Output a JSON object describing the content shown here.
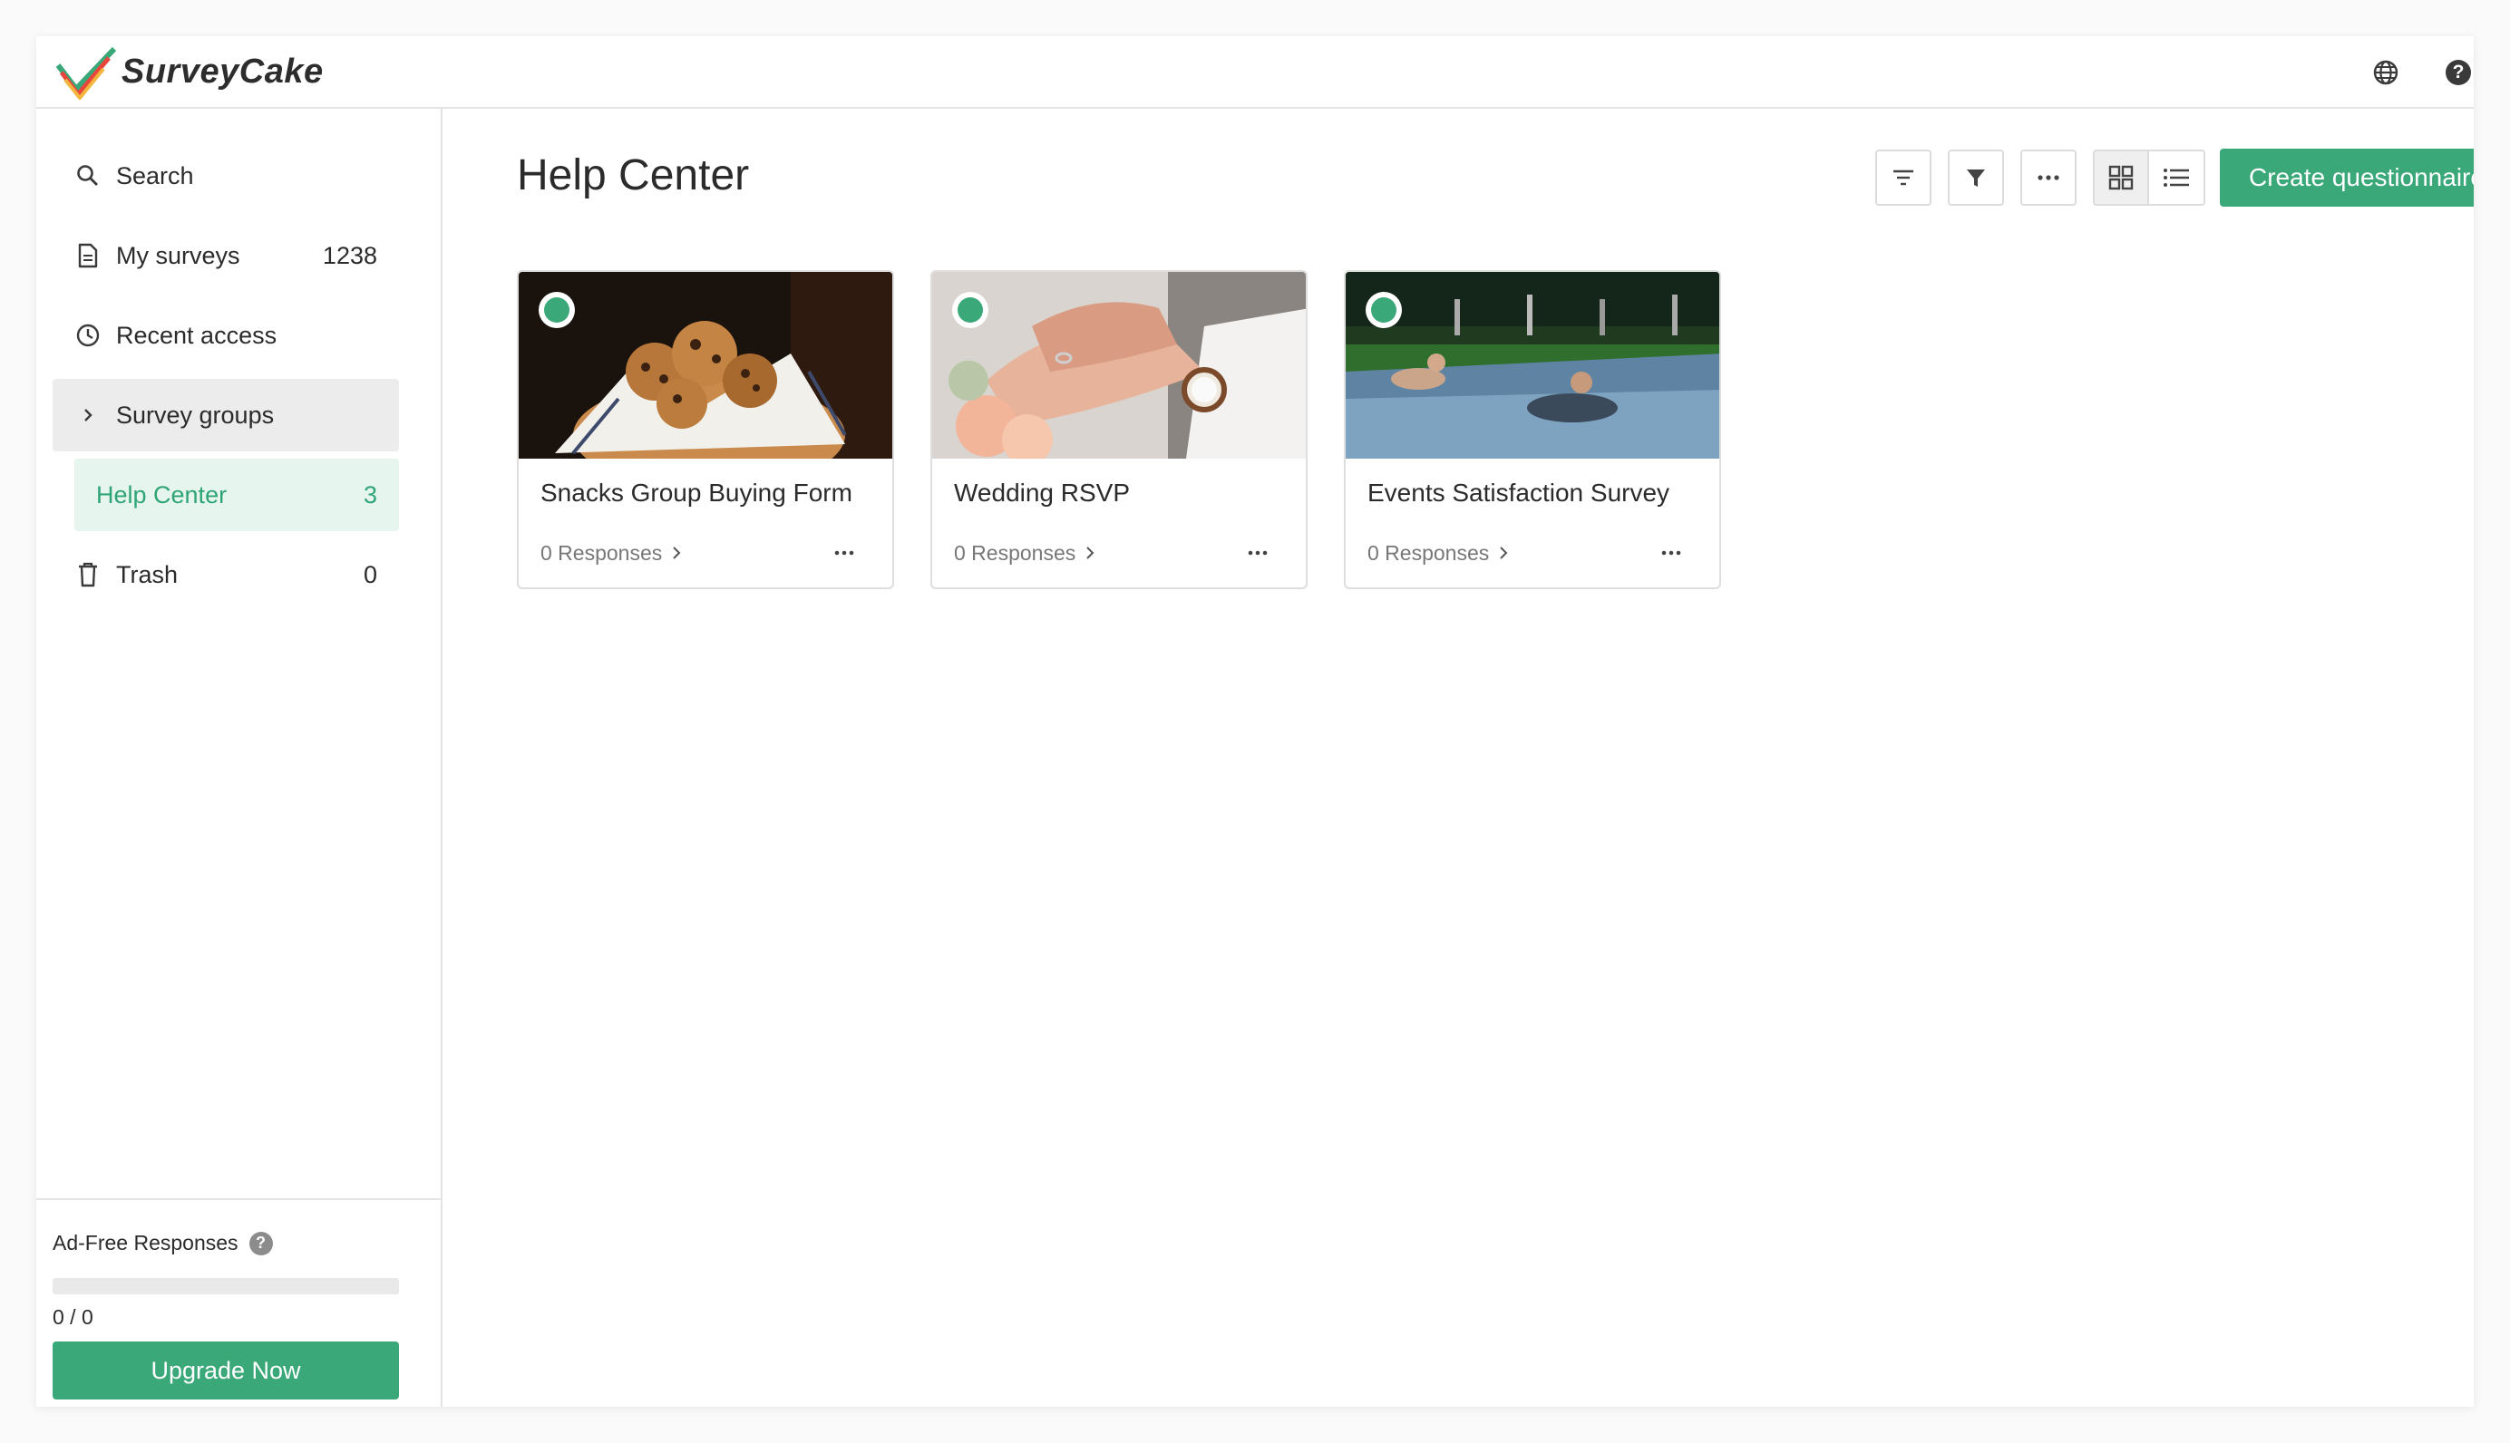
{
  "app": {
    "logo_text": "SurveyCake",
    "brand_color": "#3aa879"
  },
  "header": {
    "icons": [
      "globe-icon",
      "help-icon"
    ],
    "help_glyph": "?"
  },
  "sidebar": {
    "items": [
      {
        "label": "Search",
        "icon": "search-icon",
        "count": ""
      },
      {
        "label": "My surveys",
        "icon": "document-icon",
        "count": "1238"
      },
      {
        "label": "Recent access",
        "icon": "clock-icon",
        "count": ""
      },
      {
        "label": "Survey groups",
        "icon": "chevron-right-icon",
        "count": ""
      },
      {
        "label": "Help Center",
        "icon": "",
        "count": "3",
        "active": true
      },
      {
        "label": "Trash",
        "icon": "trash-icon",
        "count": "0"
      }
    ],
    "ad_free": {
      "title": "Ad-Free Responses",
      "help_glyph": "?",
      "progress_fraction": 0,
      "progress_text": "0 / 0"
    },
    "upgrade_label": "Upgrade Now"
  },
  "main": {
    "title": "Help Center",
    "toolbar": {
      "icons": [
        "sort-icon",
        "filter-icon",
        "more-horizontal-icon",
        "grid-view-icon",
        "list-view-icon"
      ],
      "create_label": "Create questionnaire"
    },
    "cards": [
      {
        "title": "Snacks Group Buying Form",
        "responses": "0 Responses",
        "status": "active",
        "image": "cookies-basket"
      },
      {
        "title": "Wedding RSVP",
        "responses": "0 Responses",
        "status": "active",
        "image": "wedding-hands"
      },
      {
        "title": "Events Satisfaction Survey",
        "responses": "0 Responses",
        "status": "active",
        "image": "water-slide"
      }
    ]
  }
}
